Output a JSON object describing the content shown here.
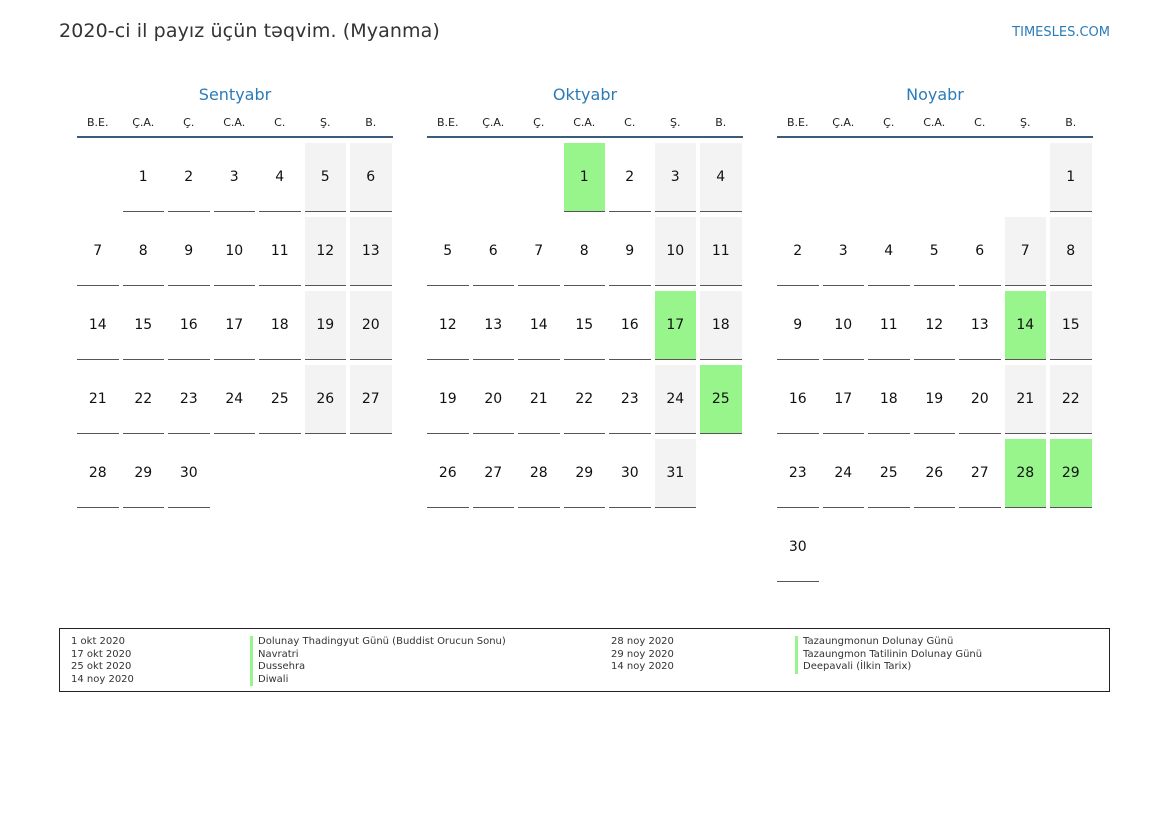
{
  "header": {
    "title": "2020-ci il payız üçün təqvim. (Myanma)",
    "site": "TIMESLES.COM"
  },
  "colors": {
    "accent": "#2b7bb9",
    "holiday": "#97f58c",
    "weekend": "#f3f3f3"
  },
  "weekdays": [
    "B.E.",
    "Ç.A.",
    "Ç.",
    "C.A.",
    "C.",
    "Ş.",
    "B."
  ],
  "months": [
    {
      "name": "Sentyabr",
      "offset": 1,
      "days": 30,
      "holidays": []
    },
    {
      "name": "Oktyabr",
      "offset": 3,
      "days": 31,
      "holidays": [
        1,
        17,
        25
      ]
    },
    {
      "name": "Noyabr",
      "offset": 6,
      "days": 30,
      "holidays": [
        14,
        28,
        29
      ]
    }
  ],
  "legend": {
    "left": [
      {
        "date": "1 okt 2020",
        "name": "Dolunay Thadingyut Günü (Buddist Orucun Sonu)"
      },
      {
        "date": "17 okt 2020",
        "name": "Navratri"
      },
      {
        "date": "25 okt 2020",
        "name": "Dussehra"
      },
      {
        "date": "14 noy 2020",
        "name": "Diwali"
      }
    ],
    "right": [
      {
        "date": "28 noy 2020",
        "name": "Tazaungmonun Dolunay Günü"
      },
      {
        "date": "29 noy 2020",
        "name": "Tazaungmon Tatilinin Dolunay Günü"
      },
      {
        "date": "14 noy 2020",
        "name": "Deepavali (İlkin Tarix)"
      }
    ]
  }
}
